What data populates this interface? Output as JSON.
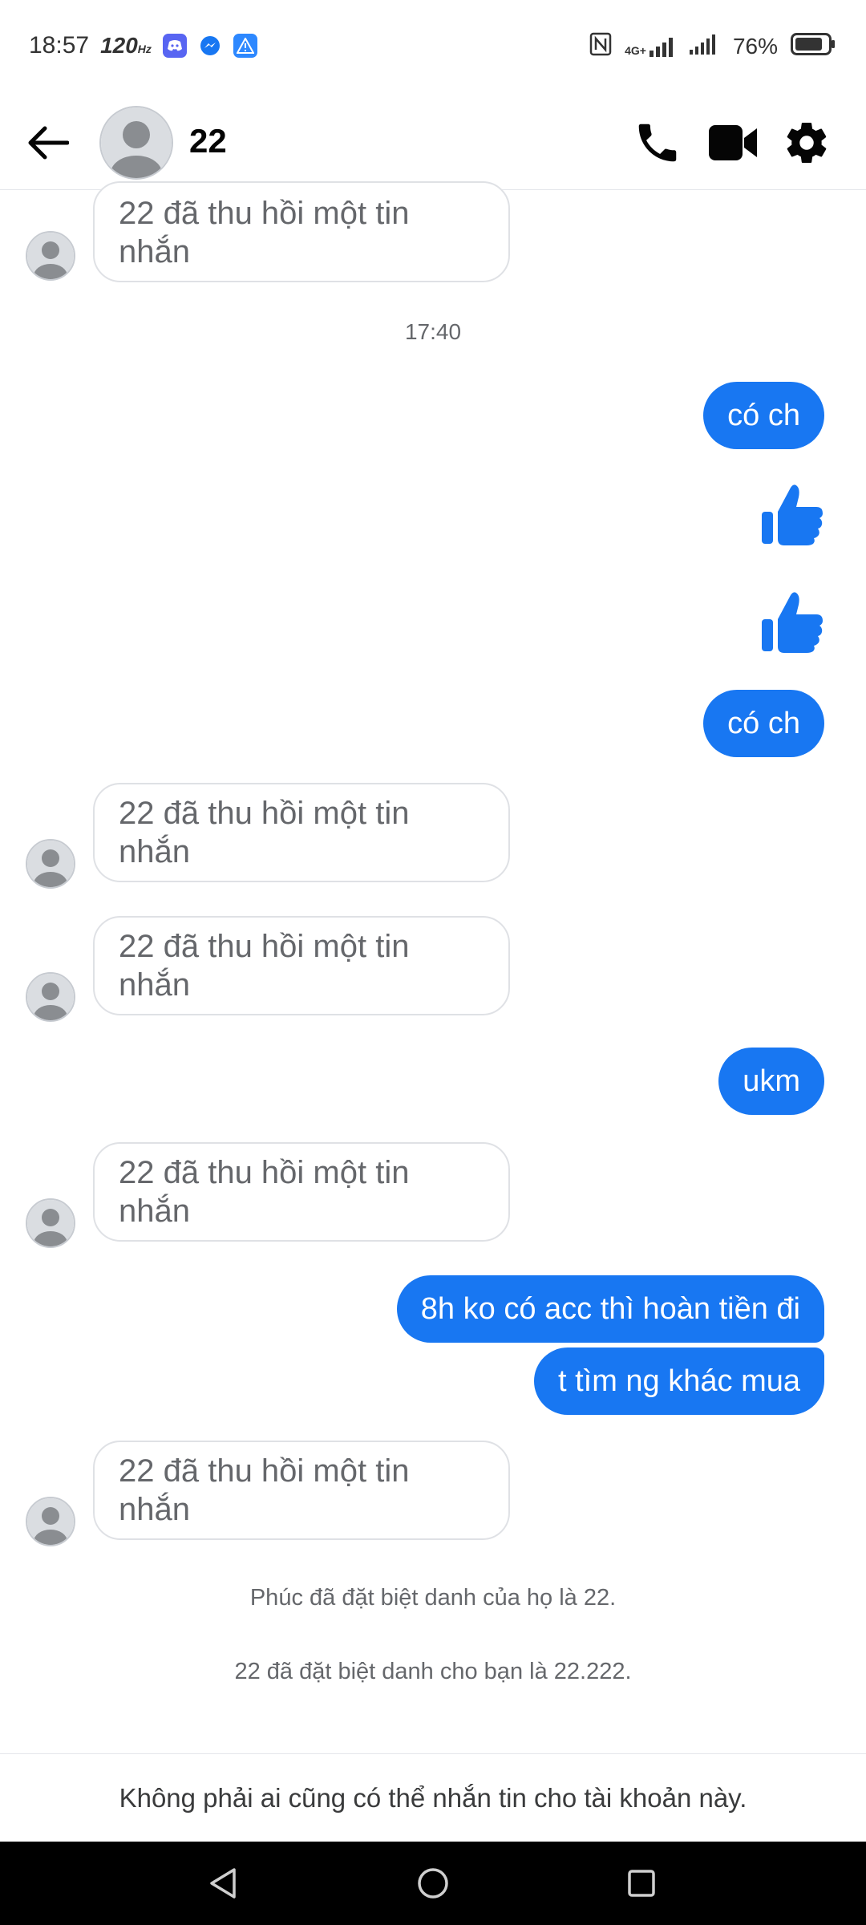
{
  "status_bar": {
    "time": "18:57",
    "refresh_rate": "120",
    "network": "4G+",
    "battery": "76%",
    "icons": [
      "discord-icon",
      "messenger-icon",
      "alert-icon",
      "nfc-icon",
      "signal-icon",
      "battery-icon"
    ]
  },
  "header": {
    "contact_name": "22",
    "icons": [
      "back-arrow-icon",
      "avatar",
      "phone-icon",
      "video-camera-icon",
      "gear-icon"
    ]
  },
  "messages": [
    {
      "type": "received_recalled",
      "text": "22 đã thu hồi một tin nhắn"
    },
    {
      "type": "timestamp",
      "text": "17:40"
    },
    {
      "type": "sent",
      "text": "có ch"
    },
    {
      "type": "sent_like"
    },
    {
      "type": "sent_like"
    },
    {
      "type": "sent",
      "text": "có ch"
    },
    {
      "type": "received_recalled",
      "text": "22 đã thu hồi một tin nhắn"
    },
    {
      "type": "received_recalled",
      "text": "22 đã thu hồi một tin nhắn"
    },
    {
      "type": "sent",
      "text": "ukm"
    },
    {
      "type": "received_recalled",
      "text": "22 đã thu hồi một tin nhắn"
    },
    {
      "type": "sent",
      "text": "8h ko có acc thì hoàn tiền đi"
    },
    {
      "type": "sent",
      "text": "t tìm ng khác mua"
    },
    {
      "type": "received_recalled",
      "text": "22 đã thu hồi một tin nhắn"
    },
    {
      "type": "system",
      "text": "Phúc đã đặt biệt danh của họ là 22."
    },
    {
      "type": "system",
      "text": "22 đã đặt biệt danh cho bạn là 22.222."
    }
  ],
  "footer_notice": "Không phải ai cũng có thể nhắn tin cho tài khoản này.",
  "colors": {
    "accent": "#1877f2",
    "bubble_text": "#ffffff",
    "secondary_text": "#65676b"
  }
}
